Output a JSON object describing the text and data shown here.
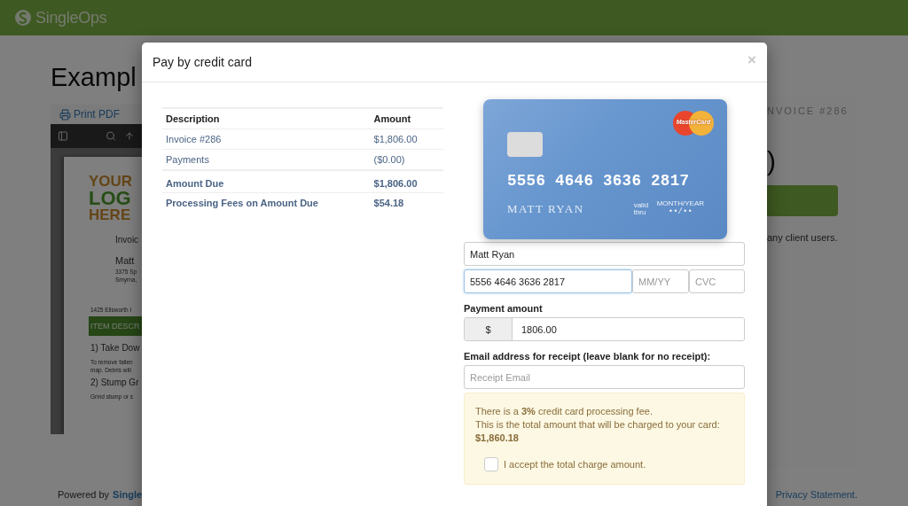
{
  "header": {
    "logo": "SingleOps"
  },
  "page": {
    "title": "Exampl",
    "toolbar": [
      {
        "label": "Print PDF"
      }
    ],
    "document": {
      "logo_lines": [
        "YOUR",
        "LOG",
        "HERE"
      ],
      "lines": [
        {
          "kind": "label",
          "text": "Invoic"
        },
        {
          "kind": "name",
          "text": "Matt"
        },
        {
          "kind": "small",
          "text": "3375 Sp"
        },
        {
          "kind": "small",
          "text": "Smyrna,"
        },
        {
          "kind": "gap",
          "text": "1425 Ellsworth I"
        },
        {
          "kind": "bar",
          "text": "ITEM DESCR"
        },
        {
          "kind": "heading",
          "text": "1) Take Dow"
        },
        {
          "kind": "small",
          "text": "To remove fallen"
        },
        {
          "kind": "small",
          "text": "map. Debris will"
        },
        {
          "kind": "heading",
          "text": "2) Stump Gr"
        },
        {
          "kind": "small",
          "text": "Grind stump or s"
        }
      ]
    },
    "side_card": {
      "invoice_label": "NVOICE #286",
      "amount_fragment": ")",
      "note": "any client users."
    },
    "footer": {
      "powered_by": "Powered by",
      "link": "Single",
      "privacy": "Privacy Statement."
    }
  },
  "modal": {
    "title": "Pay by credit card",
    "close": "×",
    "table": {
      "columns": [
        "Description",
        "Amount"
      ],
      "rows": [
        {
          "kind": "item",
          "description": "Invoice #286",
          "amount": "$1,806.00"
        },
        {
          "kind": "item",
          "description": "Payments",
          "amount": "($0.00)"
        },
        {
          "kind": "total",
          "description": "Amount Due",
          "amount": "$1,806.00"
        },
        {
          "kind": "total",
          "description": "Processing Fees on Amount Due",
          "amount": "$54.18"
        }
      ]
    },
    "card": {
      "brand": "MasterCard",
      "number": "5556 4646 3636 2817",
      "holder": "MATT RYAN",
      "valid_label": "valid thru",
      "expiry_label": "MONTH/YEAR",
      "expiry": "••/••"
    },
    "form": {
      "name": {
        "value": "Matt Ryan",
        "focused": false
      },
      "number": {
        "value": "5556 4646 3636 2817",
        "focused": true
      },
      "expiry": {
        "placeholder": "MM/YY"
      },
      "cvc": {
        "placeholder": "CVC"
      },
      "payment_label": "Payment amount",
      "currency": "$",
      "amount": "1806.00",
      "email_label": "Email address for receipt (leave blank for no receipt):",
      "email_placeholder": "Receipt Email"
    },
    "notice": {
      "line1": "There is a **3%** credit card processing fee.",
      "line2": "This is the total amount that will be charged to your card:",
      "total": "$1,860.18",
      "accept_label": "I accept the total charge amount.",
      "accepted": false
    }
  }
}
